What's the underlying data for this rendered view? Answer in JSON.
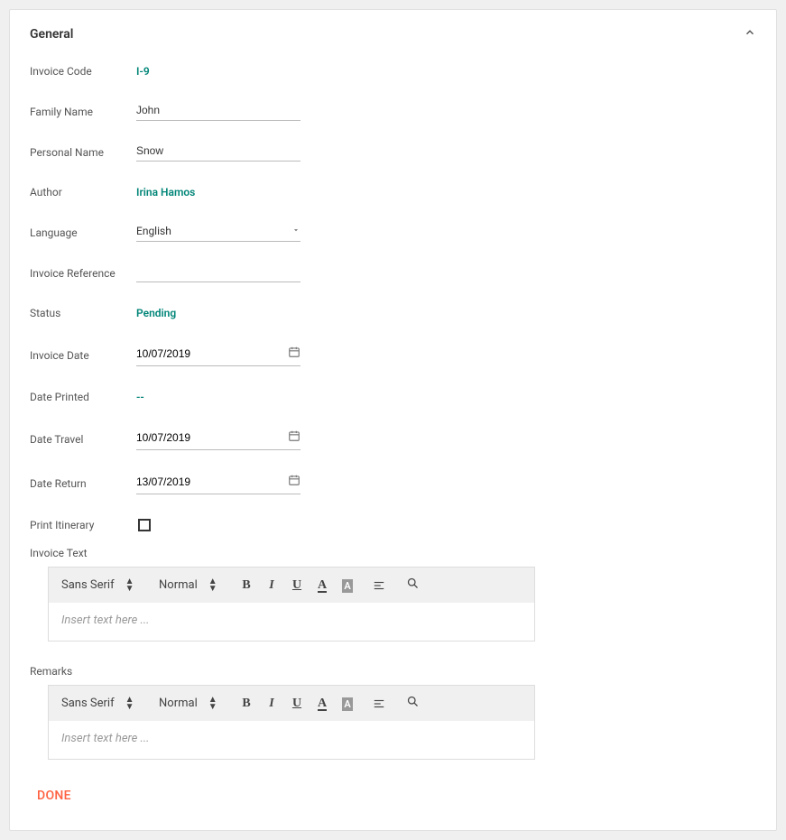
{
  "panel": {
    "title": "General"
  },
  "fields": {
    "invoice_code": {
      "label": "Invoice Code",
      "value": "I-9"
    },
    "family_name": {
      "label": "Family Name",
      "value": "John"
    },
    "personal_name": {
      "label": "Personal Name",
      "value": "Snow"
    },
    "author": {
      "label": "Author",
      "value": "Irina Hamos"
    },
    "language": {
      "label": "Language",
      "value": "English"
    },
    "invoice_reference": {
      "label": "Invoice Reference",
      "value": ""
    },
    "status": {
      "label": "Status",
      "value": "Pending"
    },
    "invoice_date": {
      "label": "Invoice Date",
      "value": "10/07/2019"
    },
    "date_printed": {
      "label": "Date Printed",
      "value": "--"
    },
    "date_travel": {
      "label": "Date Travel",
      "value": "10/07/2019"
    },
    "date_return": {
      "label": "Date Return",
      "value": "13/07/2019"
    },
    "print_itinerary": {
      "label": "Print Itinerary",
      "checked": false
    },
    "invoice_text": {
      "label": "Invoice Text",
      "placeholder": "Insert text here ..."
    },
    "remarks": {
      "label": "Remarks",
      "placeholder": "Insert text here ..."
    }
  },
  "toolbar": {
    "font": "Sans Serif",
    "size": "Normal"
  },
  "actions": {
    "done": "DONE"
  },
  "colors": {
    "link": "#008577",
    "accent": "#ff6040"
  }
}
